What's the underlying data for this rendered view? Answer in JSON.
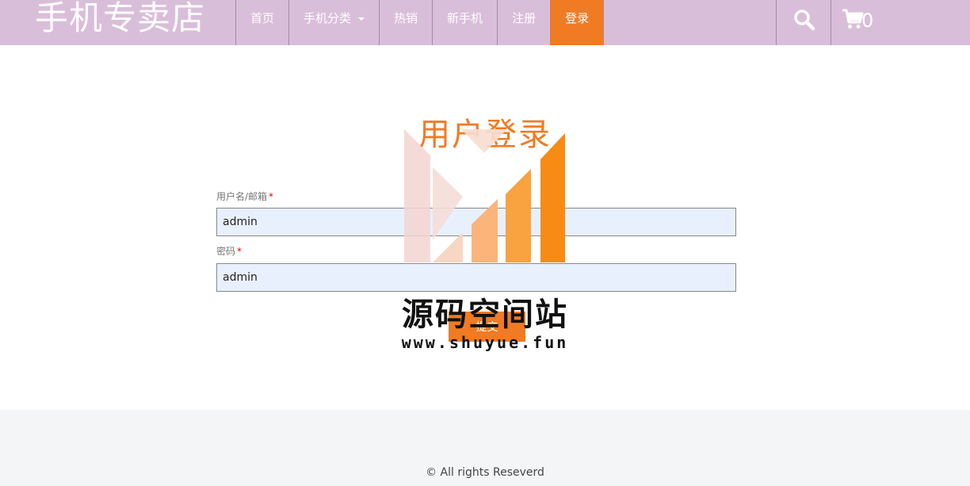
{
  "header": {
    "brand": "手机专卖店",
    "nav": [
      {
        "label": "首页"
      },
      {
        "label": "手机分类"
      },
      {
        "label": "热销"
      },
      {
        "label": "新手机"
      },
      {
        "label": "注册"
      },
      {
        "label": "登录"
      }
    ],
    "cart_count": "0",
    "icons": [
      "search-icon",
      "cart-icon",
      "chevron-down-icon"
    ],
    "colors": {
      "bar": "#d9bed9",
      "accent": "#f07b23"
    }
  },
  "login": {
    "title": "用户登录",
    "username_label": "用户名/邮箱",
    "username_value": "admin",
    "password_label": "密码",
    "password_value": "admin",
    "required_mark": "*",
    "submit_label": "提交"
  },
  "watermark": {
    "text": "源码空间站",
    "url": "www.shuyue.fun"
  },
  "footer": {
    "text": "© All rights Reseverd"
  }
}
